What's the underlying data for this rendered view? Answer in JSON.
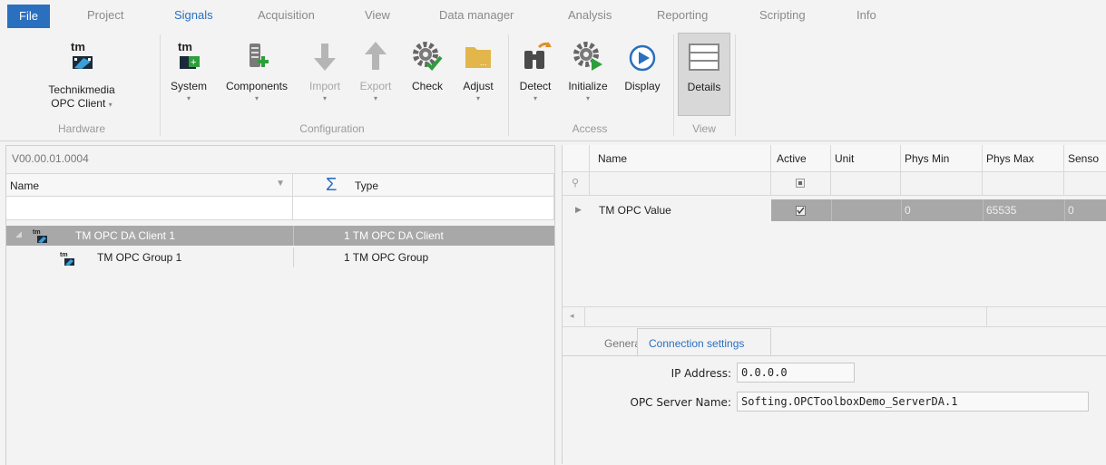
{
  "menu": [
    "File",
    "Project",
    "Signals",
    "Acquisition",
    "View",
    "Data manager",
    "Analysis",
    "Reporting",
    "Scripting",
    "Info"
  ],
  "ribbon": {
    "hardware": {
      "label_line1": "Technikmedia",
      "label_line2": "OPC Client",
      "group": "Hardware"
    },
    "configuration": {
      "system": "System",
      "components": "Components",
      "import": "Import",
      "export": "Export",
      "check": "Check",
      "adjust": "Adjust",
      "group": "Configuration"
    },
    "access": {
      "detect": "Detect",
      "initialize": "Initialize",
      "display": "Display",
      "group": "Access"
    },
    "view": {
      "details": "Details",
      "group": "View"
    }
  },
  "left": {
    "version": "V00.00.01.0004",
    "col_name": "Name",
    "col_sigma": "Σ",
    "col_type": "Type",
    "rows": [
      {
        "name": "TM OPC DA Client 1",
        "type": "1 TM OPC DA Client"
      },
      {
        "name": "TM OPC Group 1",
        "type": "1 TM OPC Group"
      }
    ]
  },
  "grid": {
    "headers": [
      "Name",
      "Active",
      "Unit",
      "Phys Min",
      "Phys Max",
      "Senso"
    ],
    "row": {
      "name": "TM OPC Value",
      "unit": "",
      "phys_min": "0",
      "phys_max": "65535",
      "sensor": "0"
    }
  },
  "tabs": {
    "general": "General",
    "connection": "Connection settings"
  },
  "settings": {
    "ip_label": "IP Address:",
    "ip_value": "0.0.0.0",
    "server_label": "OPC Server Name:",
    "server_value": "Softing.OPCToolboxDemo_ServerDA.1"
  },
  "colors": {
    "accent": "#2b6fbf",
    "selected_row": "#a8a8a8"
  }
}
